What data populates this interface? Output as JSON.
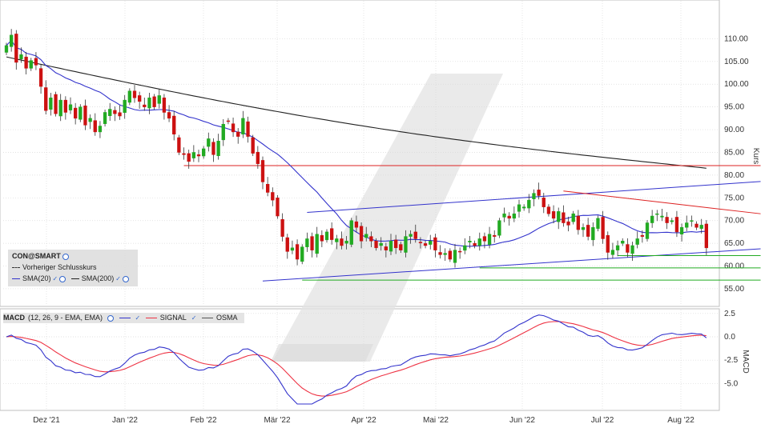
{
  "chart_data": [
    {
      "type": "candlestick",
      "instrument": "CON@SMART",
      "ylabel": "Kurs",
      "ylim": [
        52,
        115
      ],
      "yticks": [
        "110.00",
        "105.00",
        "100.00",
        "95.00",
        "90.00",
        "85.00",
        "80.00",
        "75.00",
        "70.00",
        "65.00",
        "60.00",
        "55.00"
      ],
      "ytick_values": [
        110,
        105,
        100,
        95,
        90,
        85,
        80,
        75,
        70,
        65,
        60,
        55
      ],
      "x_month_labels": [
        "Dez '21",
        "Jan '22",
        "Feb '22",
        "Mär '22",
        "Apr '22",
        "Mai '22",
        "Jun '22",
        "Jul '22",
        "Aug '22"
      ],
      "legend": {
        "title": "CON@SMART",
        "prev_close_label": "Vorheriger Schlusskurs",
        "sma20_label": "SMA(20)",
        "sma200_label": "SMA(200)"
      },
      "candles_close": [
        108.5,
        110.8,
        104.8,
        106.5,
        103.5,
        105.2,
        104.2,
        99.5,
        94.2,
        97.0,
        93.5,
        96.5,
        93.8,
        95.5,
        92.5,
        95.0,
        91.0,
        92.5,
        89.5,
        90.8,
        93.8,
        94.5,
        93.5,
        93.0,
        96.5,
        98.5,
        97.0,
        96.2,
        95.0,
        97.0,
        95.0,
        97.5,
        93.8,
        92.5,
        89.0,
        85.0,
        84.5,
        83.0,
        85.0,
        84.2,
        85.8,
        88.0,
        84.5,
        87.5,
        91.2,
        91.8,
        89.5,
        88.5,
        92.5,
        88.5,
        84.8,
        82.5,
        78.5,
        76.2,
        74.5,
        71.0,
        66.5,
        63.2,
        64.0,
        61.5,
        64.2,
        66.0,
        63.5,
        67.0,
        65.5,
        67.5,
        65.8,
        66.0,
        64.5,
        65.5,
        70.0,
        68.5,
        65.5,
        67.0,
        65.5,
        64.0,
        65.0,
        63.5,
        65.5,
        64.0,
        63.5,
        66.5,
        67.0,
        66.0,
        65.2,
        64.5,
        65.5,
        63.5,
        62.5,
        62.8,
        61.5,
        63.5,
        63.2,
        64.5,
        65.5,
        64.5,
        66.0,
        65.5,
        67.0,
        66.5,
        70.0,
        71.5,
        70.5,
        71.5,
        73.5,
        73.0,
        74.5,
        76.0,
        75.5,
        73.0,
        71.5,
        70.5,
        72.0,
        69.5,
        69.0,
        71.5,
        68.0,
        68.5,
        66.5,
        68.5,
        70.5,
        66.0,
        63.0,
        63.5,
        64.5,
        65.5,
        63.0,
        64.5,
        66.0,
        66.5,
        69.5,
        71.0,
        71.5,
        71.0,
        69.5,
        70.0,
        67.5,
        68.5,
        69.5,
        70.0,
        68.5,
        69.0,
        64.0
      ],
      "trendlines": [
        {
          "name": "support-line",
          "color": "#3333cc",
          "from": [
            52,
            56.7
          ],
          "to": [
            153,
            63.8
          ]
        },
        {
          "name": "upper-channel",
          "color": "#3333cc",
          "from": [
            61,
            71.8
          ],
          "to": [
            153,
            78.6
          ]
        },
        {
          "name": "red-resistance",
          "color": "#dd2222",
          "from": [
            113,
            76.5
          ],
          "to": [
            153,
            71.5
          ]
        },
        {
          "name": "red-horizontal",
          "color": "#dd2222",
          "from": [
            36,
            82.1
          ],
          "to": [
            153,
            82.1
          ]
        },
        {
          "name": "green-1",
          "color": "#22aa22",
          "from": [
            124,
            62.3
          ],
          "to": [
            153,
            62.3
          ]
        },
        {
          "name": "green-2",
          "color": "#22aa22",
          "from": [
            96,
            59.6
          ],
          "to": [
            153,
            59.6
          ]
        },
        {
          "name": "green-3",
          "color": "#22aa22",
          "from": [
            60,
            56.9
          ],
          "to": [
            153,
            56.9
          ]
        }
      ]
    },
    {
      "type": "line",
      "indicator": "MACD",
      "params": "(12, 26, 9 - EMA, EMA)",
      "ylabel": "MACD",
      "ylim": [
        -7.2,
        3.0
      ],
      "yticks": [
        "2.5",
        "0.0",
        "-2.5",
        "-5.0"
      ],
      "ytick_values": [
        2.5,
        0.0,
        -2.5,
        -5.0
      ],
      "legend": {
        "title": "MACD",
        "params": "(12, 26, 9 - EMA, EMA)",
        "signal_label": "SIGNAL",
        "osma_label": "OSMA"
      },
      "colors": {
        "macd": "#3333cc",
        "signal": "#ee3344"
      }
    }
  ],
  "colors": {
    "up": "#22aa22",
    "down": "#cc1111",
    "sma20": "#3333cc",
    "sma200": "#222222",
    "grid": "#d9d9d9"
  }
}
